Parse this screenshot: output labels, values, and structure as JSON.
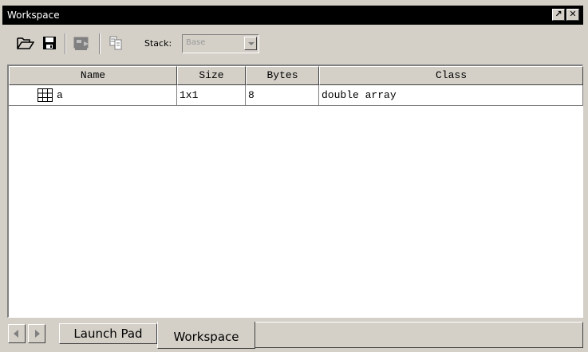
{
  "window": {
    "title": "Workspace"
  },
  "toolbar": {
    "stack_label": "Stack:",
    "stack_value": "Base",
    "icons": [
      "open-folder-icon",
      "save-icon",
      "import-data-icon",
      "copy-icon"
    ]
  },
  "table": {
    "columns": [
      "Name",
      "Size",
      "Bytes",
      "Class"
    ],
    "rows": [
      {
        "name": "a",
        "size": "1x1",
        "bytes": "8",
        "class": "double array"
      }
    ]
  },
  "tabs": [
    {
      "label": "Launch Pad",
      "active": false
    },
    {
      "label": "Workspace",
      "active": true
    }
  ],
  "colors": {
    "titlebar_bg": "#000000",
    "face": "#d4d0c8",
    "grid_icon": "#000000"
  }
}
